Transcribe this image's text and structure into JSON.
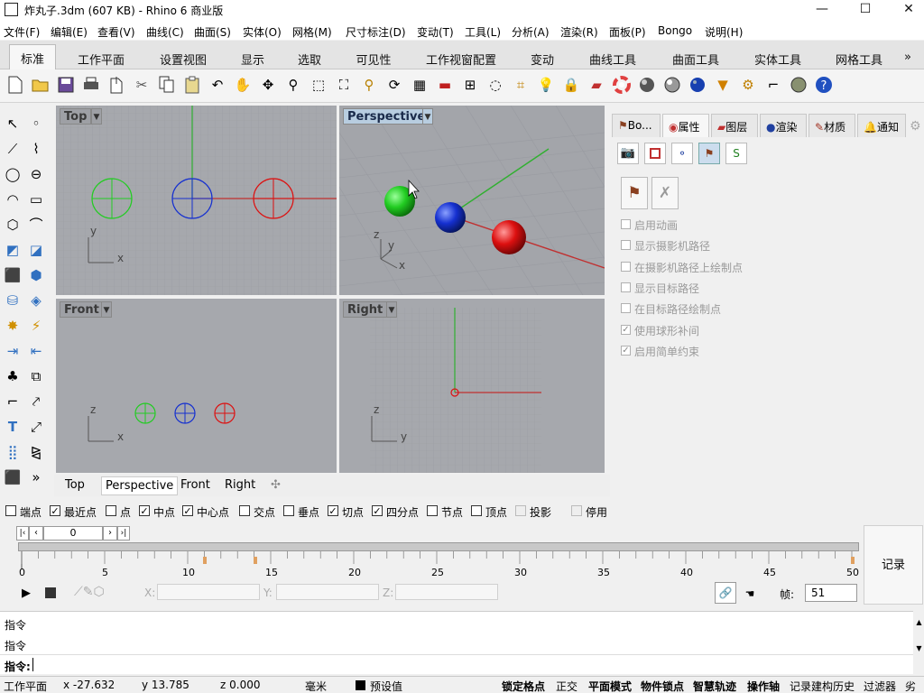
{
  "window": {
    "title": "炸丸子.3dm (607 KB) - Rhino 6 商业版",
    "minimize": "—",
    "maximize": "☐",
    "close": "✕"
  },
  "menu": [
    "文件(F)",
    "编辑(E)",
    "查看(V)",
    "曲线(C)",
    "曲面(S)",
    "实体(O)",
    "网格(M)",
    "尺寸标注(D)",
    "变动(T)",
    "工具(L)",
    "分析(A)",
    "渲染(R)",
    "面板(P)",
    "Bongo",
    "说明(H)"
  ],
  "tabs": [
    "标准",
    "工作平面",
    "设置视图",
    "显示",
    "选取",
    "可见性",
    "工作视窗配置",
    "变动",
    "曲线工具",
    "曲面工具",
    "实体工具",
    "网格工具"
  ],
  "tabs_more": "»",
  "toolbar_icons": [
    "new-icon",
    "open-icon",
    "save-icon",
    "print-icon",
    "import-icon",
    "cut-icon",
    "copy-icon",
    "paste-icon",
    "undo-icon",
    "pan-icon",
    "rotate-icon",
    "zoom-icon",
    "zoom-window-icon",
    "zoom-extents-icon",
    "zoom-selected-icon",
    "rotate-view-icon",
    "viewport-layout-icon",
    "car-icon",
    "grid-icon",
    "circle-icon",
    "point-edit-icon",
    "light-icon",
    "lock-icon",
    "book-icon",
    "color-wheel-icon",
    "sphere-gray-icon",
    "sphere-white-icon",
    "sphere-blue-icon",
    "cone-icon",
    "gear-icon",
    "dimension-icon",
    "globe-icon",
    "help-icon"
  ],
  "viewports": {
    "top": {
      "label": "Top",
      "axis_y": "y",
      "axis_x": "x"
    },
    "perspective": {
      "label": "Perspective",
      "axis_z": "z",
      "axis_y": "y",
      "axis_x": "x"
    },
    "front": {
      "label": "Front",
      "axis_z": "z",
      "axis_x": "x"
    },
    "right": {
      "label": "Right",
      "axis_z": "z",
      "axis_y": "y"
    }
  },
  "viewport_tabs": [
    "Top",
    "Perspective",
    "Front",
    "Right"
  ],
  "viewport_tab_add": "✣",
  "panel": {
    "tabs": [
      "Bo...",
      "属性",
      "图层",
      "渲染",
      "材质",
      "通知"
    ],
    "options": [
      {
        "label": "启用动画",
        "checked": false
      },
      {
        "label": "显示摄影机路径",
        "checked": false
      },
      {
        "label": "在摄影机路径上绘制点",
        "checked": false
      },
      {
        "label": "显示目标路径",
        "checked": false
      },
      {
        "label": "在目标路径绘制点",
        "checked": false
      },
      {
        "label": "使用球形补间",
        "checked": true
      },
      {
        "label": "启用简单约束",
        "checked": true
      }
    ]
  },
  "snaps": [
    {
      "label": "端点",
      "checked": false
    },
    {
      "label": "最近点",
      "checked": true
    },
    {
      "label": "点",
      "checked": false
    },
    {
      "label": "中点",
      "checked": true
    },
    {
      "label": "中心点",
      "checked": true
    },
    {
      "label": "交点",
      "checked": false
    },
    {
      "label": "垂点",
      "checked": false
    },
    {
      "label": "切点",
      "checked": true
    },
    {
      "label": "四分点",
      "checked": true
    },
    {
      "label": "节点",
      "checked": false
    },
    {
      "label": "顶点",
      "checked": false
    },
    {
      "label": "投影",
      "checked": false,
      "disabled": true
    },
    {
      "label": "停用",
      "checked": false,
      "disabled": true
    }
  ],
  "timeline": {
    "current_frame_field": "0",
    "ticks": [
      "0",
      "5",
      "10",
      "15",
      "20",
      "25",
      "30",
      "35",
      "40",
      "45",
      "50"
    ],
    "record": "记录",
    "frame_label": "帧:",
    "frame_value": "51",
    "x_label": "X:",
    "y_label": "Y:",
    "z_label": "Z:"
  },
  "command": {
    "history": [
      "指令",
      "指令"
    ],
    "prompt": "指令:"
  },
  "status": {
    "cplane": "工作平面",
    "x": "x -27.632",
    "y": "y 13.785",
    "z": "z 0.000",
    "units": "毫米",
    "layer": "预设值",
    "buttons": [
      "锁定格点",
      "正交",
      "平面模式",
      "物件锁点",
      "智慧轨迹",
      "操作轴",
      "记录建构历史",
      "过滤器",
      "劣"
    ]
  },
  "colors": {
    "viewport_bg": "#a6a8ad",
    "grid_line": "#9a9ca1",
    "axis_x": "#c03030",
    "axis_y": "#30b030",
    "ball_green": "#22cc22",
    "ball_blue": "#1530d0",
    "ball_red": "#dd1010",
    "active_viewport_label": "#b8cde0"
  }
}
